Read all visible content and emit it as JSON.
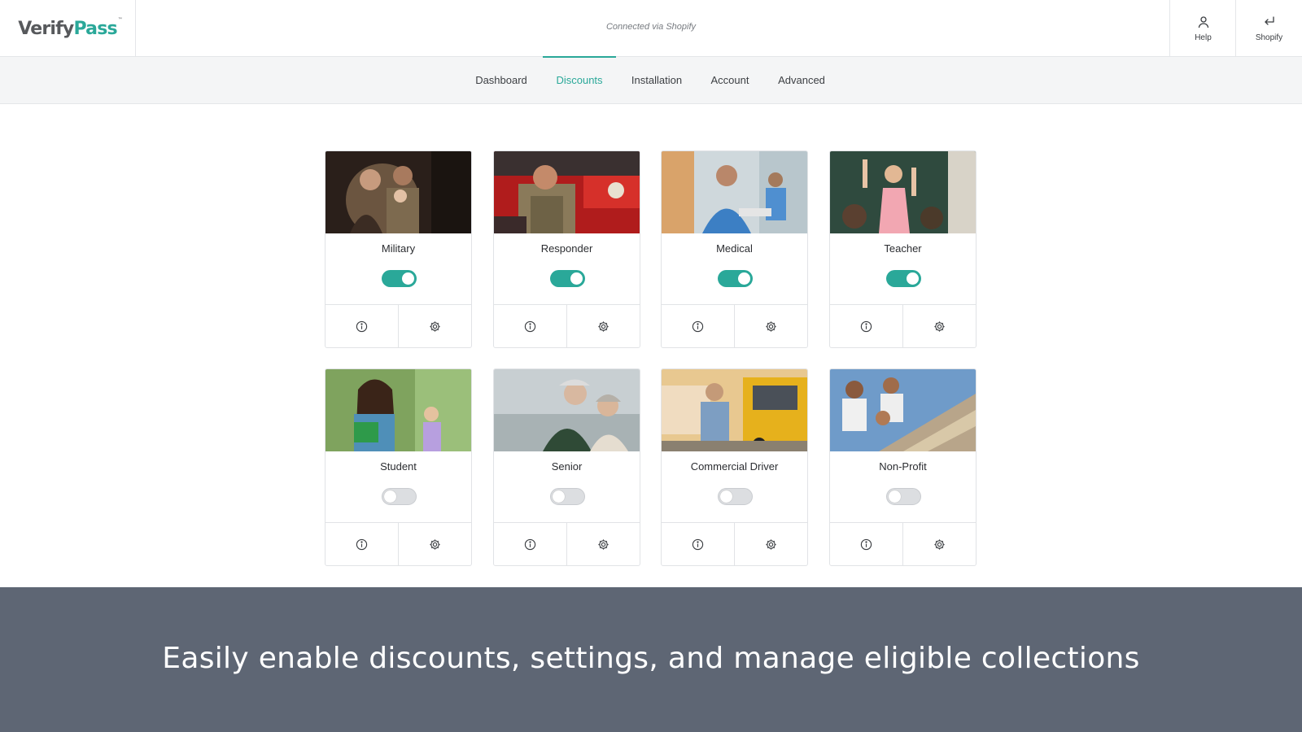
{
  "brand": {
    "logo_part1": "Verify",
    "logo_part2": "Pass",
    "trademark": "™"
  },
  "header": {
    "connection_text": "Connected via Shopify",
    "help_label": "Help",
    "shopify_label": "Shopify"
  },
  "nav": {
    "tabs": [
      {
        "label": "Dashboard",
        "active": false
      },
      {
        "label": "Discounts",
        "active": true
      },
      {
        "label": "Installation",
        "active": false
      },
      {
        "label": "Account",
        "active": false
      },
      {
        "label": "Advanced",
        "active": false
      }
    ]
  },
  "discounts": [
    {
      "title": "Military",
      "enabled": true
    },
    {
      "title": "Responder",
      "enabled": true
    },
    {
      "title": "Medical",
      "enabled": true
    },
    {
      "title": "Teacher",
      "enabled": true
    },
    {
      "title": "Student",
      "enabled": false
    },
    {
      "title": "Senior",
      "enabled": false
    },
    {
      "title": "Commercial Driver",
      "enabled": false
    },
    {
      "title": "Non-Profit",
      "enabled": false
    }
  ],
  "banner": {
    "caption": "Easily enable discounts, settings, and manage eligible collections"
  },
  "colors": {
    "accent": "#2aa899",
    "banner_bg": "#5e6674",
    "toggle_off": "#dcdee1"
  }
}
